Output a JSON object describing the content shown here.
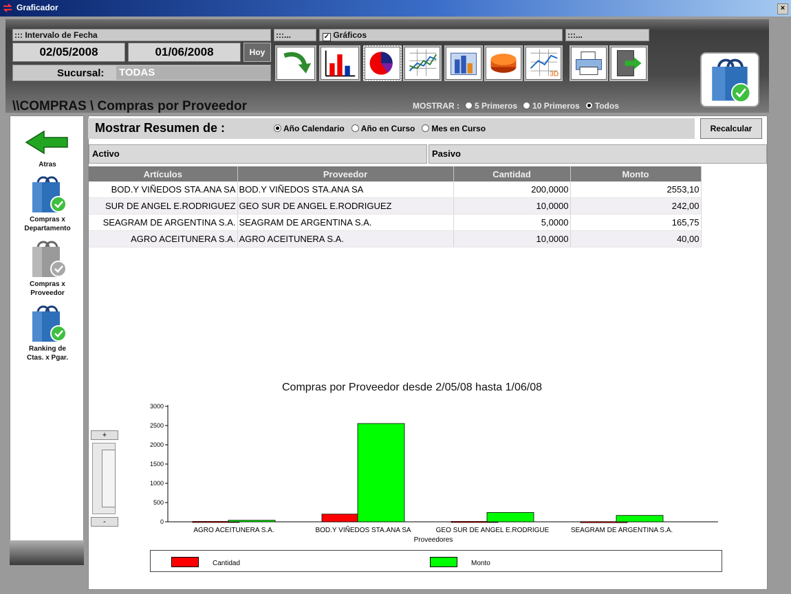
{
  "window": {
    "title": "Graficador",
    "close_label": "×"
  },
  "filters": {
    "intervalo_label": "::: Intervalo de Fecha",
    "fecha_desde": "02/05/2008",
    "fecha_hasta": "01/06/2008",
    "hoy_label": "Hoy",
    "sucursal_label": "Sucursal:",
    "sucursal_value": "TODAS",
    "group2_label": ":::...",
    "graficos_label": "Gráficos",
    "graficos_checked": true,
    "group3_label": ":::..."
  },
  "toolbar": {
    "icons": [
      "refresh-arrow-icon",
      "bar-chart-icon",
      "pie-chart-icon",
      "line-chart-icon",
      "3d-bar-chart-icon",
      "3d-pie-chart-icon",
      "3d-line-chart-icon",
      "print-icon",
      "exit-icon"
    ]
  },
  "breadcrumb": "\\\\COMPRAS \\ Compras por Proveedor",
  "mostrar": {
    "label": "MOSTRAR :",
    "options": [
      {
        "label": "5 Primeros",
        "selected": false
      },
      {
        "label": "10 Primeros",
        "selected": false
      },
      {
        "label": "Todos",
        "selected": true
      }
    ]
  },
  "sidebar": {
    "items": [
      {
        "label": "Atras",
        "icon": "back-arrow-icon"
      },
      {
        "label_line1": "Compras x",
        "label_line2": "Departamento",
        "icon": "shopping-bag-icon"
      },
      {
        "label_line1": "Compras x",
        "label_line2": "Proveedor",
        "icon": "shopping-bag-icon"
      },
      {
        "label_line1": "Ranking de",
        "label_line2": "Ctas. x Pgar.",
        "icon": "shopping-bag-icon"
      }
    ]
  },
  "resumen": {
    "label": "Mostrar Resumen de :",
    "options": [
      {
        "label": "Año Calendario",
        "selected": true
      },
      {
        "label": "Año en Curso",
        "selected": false
      },
      {
        "label": "Mes en Curso",
        "selected": false
      }
    ],
    "recalcular_label": "Recalcular"
  },
  "sections": {
    "activo": "Activo",
    "pasivo": "Pasivo"
  },
  "table": {
    "columns": [
      "Artículos",
      "Proveedor",
      "Cantidad",
      "Monto"
    ],
    "rows": [
      [
        "BOD.Y VIÑEDOS STA.ANA SA",
        "BOD.Y VIÑEDOS STA.ANA SA",
        "200,0000",
        "2553,10"
      ],
      [
        "SUR DE ANGEL E.RODRIGUEZ",
        "GEO SUR DE ANGEL E.RODRIGUEZ",
        "10,0000",
        "242,00"
      ],
      [
        "SEAGRAM DE ARGENTINA S.A.",
        "SEAGRAM DE ARGENTINA S.A.",
        "5,0000",
        "165,75"
      ],
      [
        "AGRO ACEITUNERA S.A.",
        "AGRO ACEITUNERA S.A.",
        "10,0000",
        "40,00"
      ]
    ]
  },
  "zoom": {
    "plus_label": "+",
    "minus_label": "-"
  },
  "colors": {
    "cantidad": "#ff0000",
    "monto": "#00ff00"
  },
  "chart_data": {
    "type": "bar",
    "title": "Compras por Proveedor desde 2/05/08  hasta 1/06/08",
    "xlabel": "Proveedores",
    "ylabel": "",
    "ylim": [
      0,
      3000
    ],
    "yticks": [
      0,
      500,
      1000,
      1500,
      2000,
      2500,
      3000
    ],
    "categories": [
      "AGRO ACEITUNERA S.A.",
      "BOD.Y VIÑEDOS STA.ANA SA",
      "GEO SUR DE ANGEL E.RODRIGUE",
      "SEAGRAM DE ARGENTINA S.A."
    ],
    "series": [
      {
        "name": "Cantidad",
        "values": [
          10,
          200,
          10,
          5
        ]
      },
      {
        "name": "Monto",
        "values": [
          40,
          2553.1,
          242,
          165.75
        ]
      }
    ],
    "legend_position": "bottom"
  }
}
